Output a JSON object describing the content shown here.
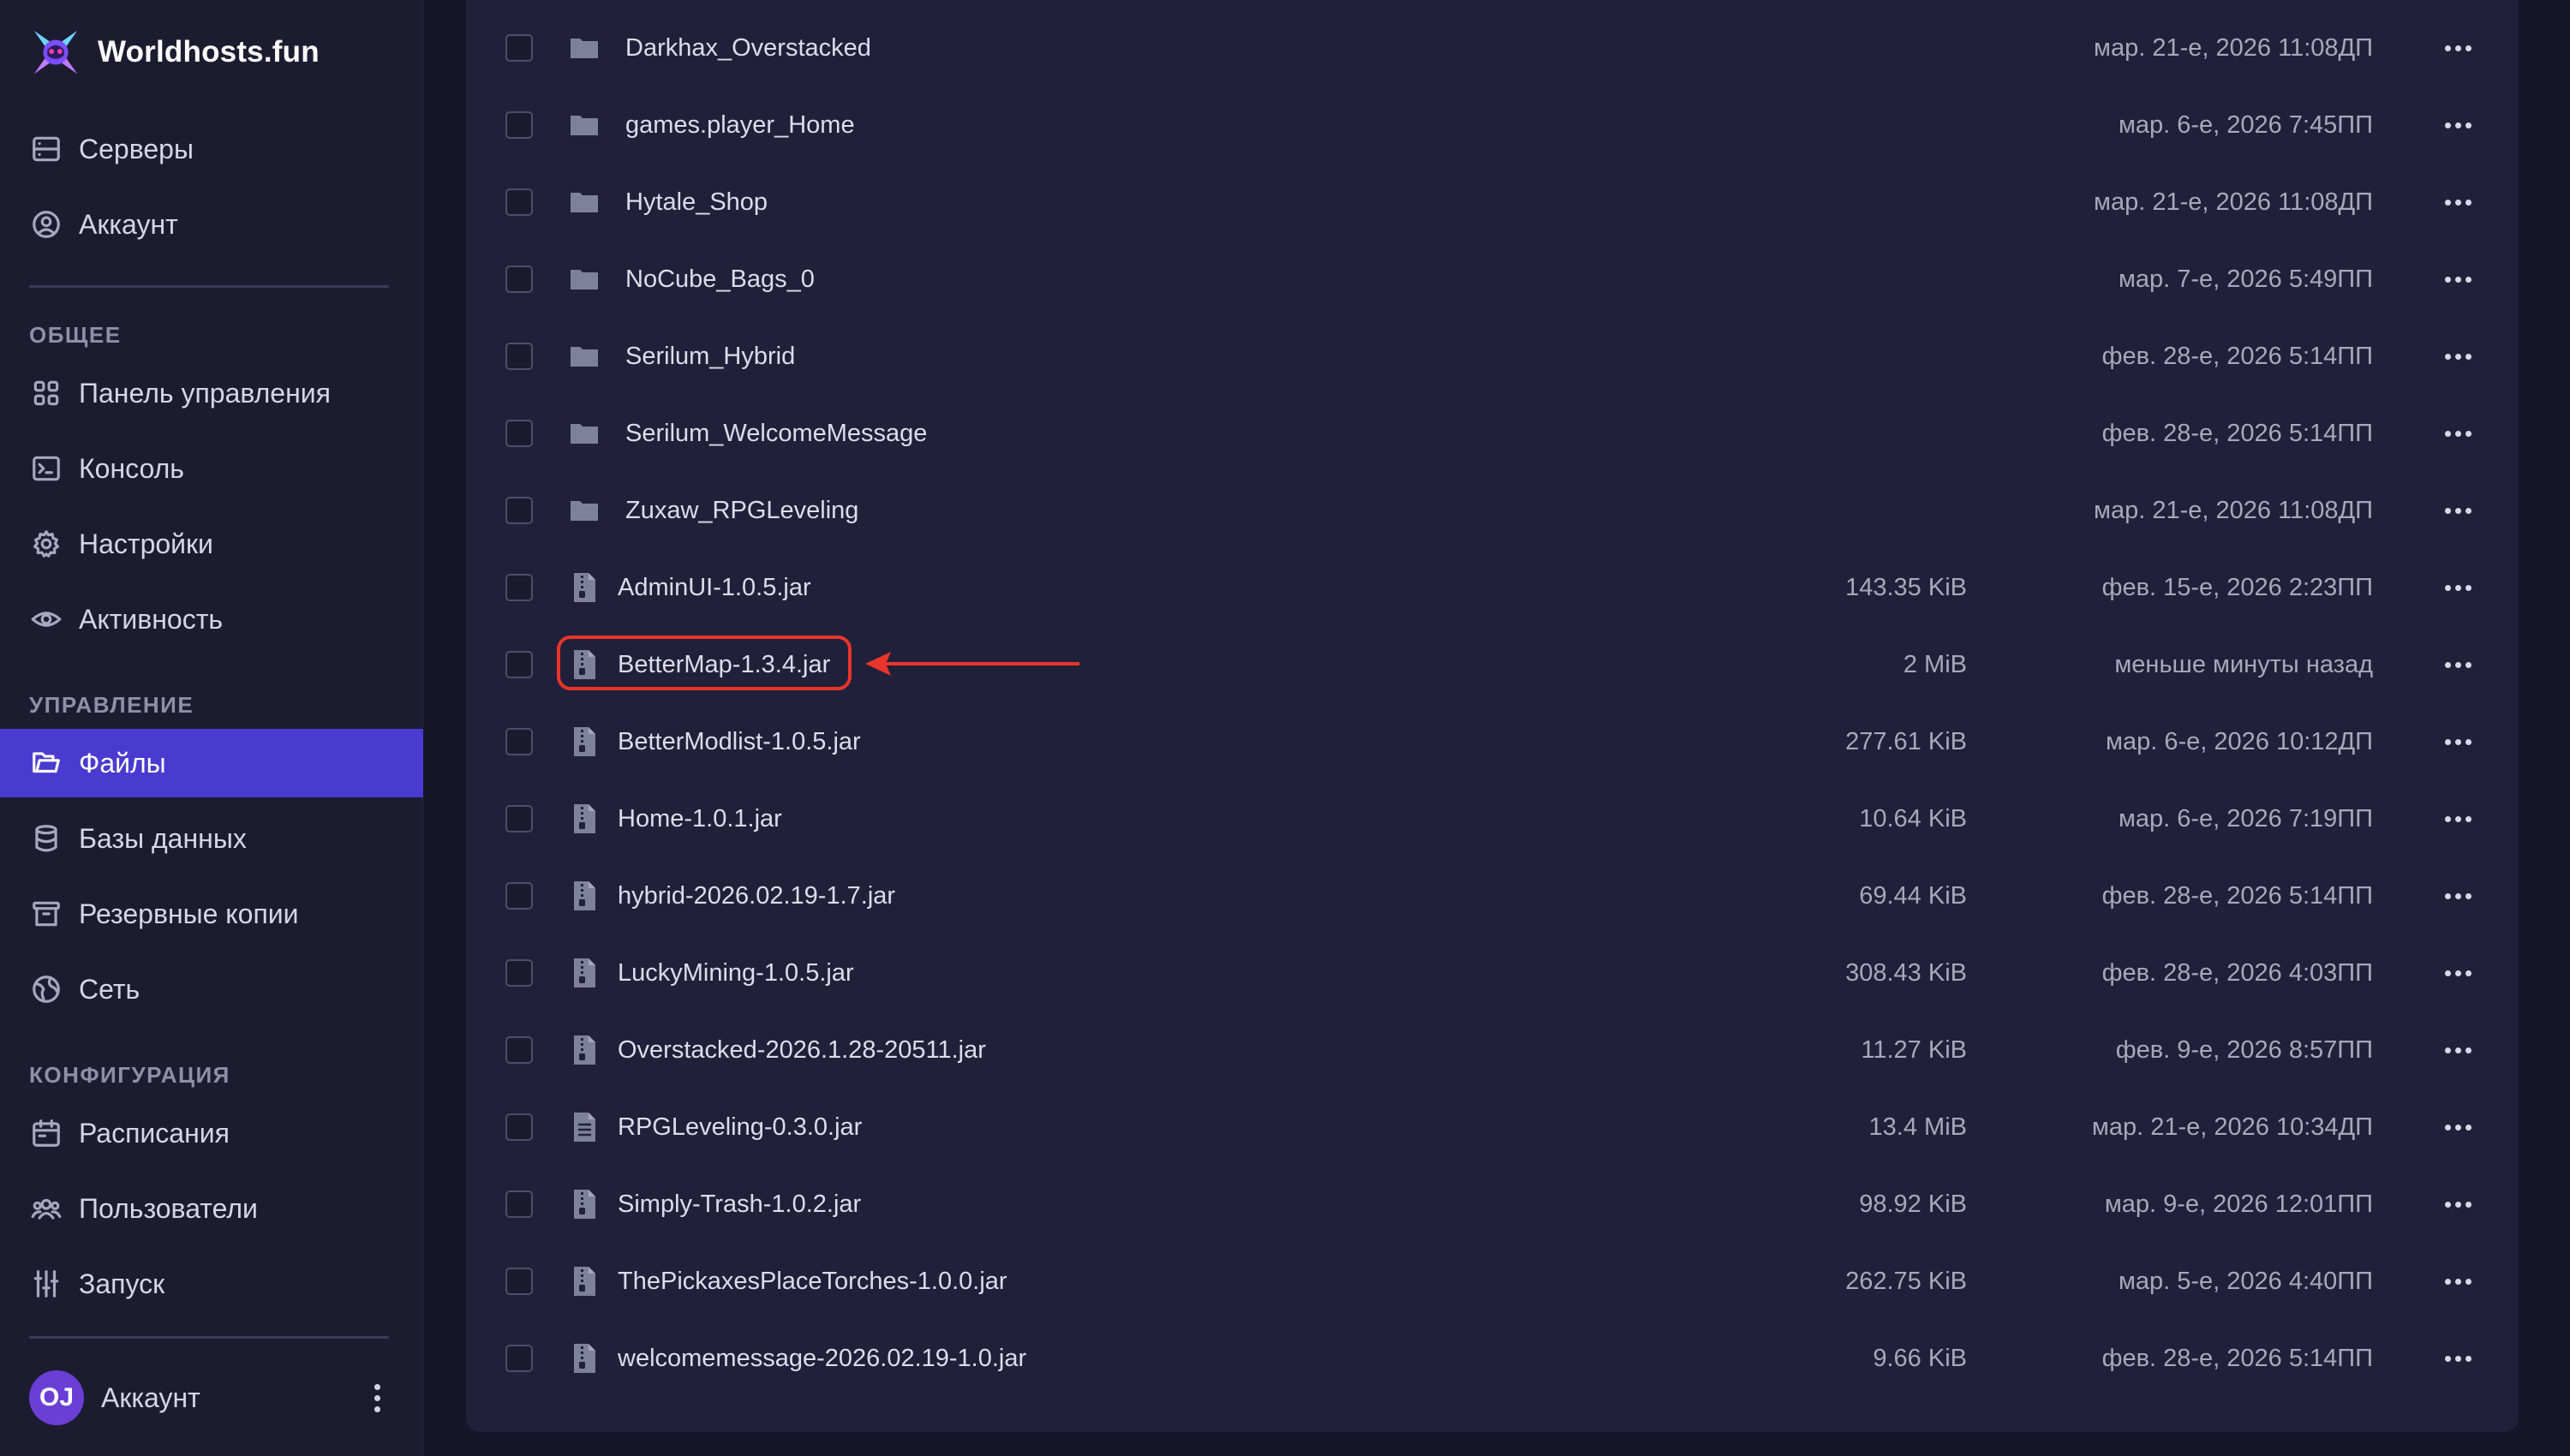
{
  "brand": {
    "name": "Worldhosts.fun"
  },
  "nav_top": [
    {
      "label": "Серверы",
      "icon": "server-icon"
    },
    {
      "label": "Аккаунт",
      "icon": "user-circle-icon"
    }
  ],
  "sections": {
    "general": "ОБЩЕЕ",
    "management": "УПРАВЛЕНИЕ",
    "configuration": "КОНФИГУРАЦИЯ"
  },
  "nav_general": [
    {
      "label": "Панель управления",
      "icon": "grid-icon"
    },
    {
      "label": "Консоль",
      "icon": "terminal-icon"
    },
    {
      "label": "Настройки",
      "icon": "gear-icon"
    },
    {
      "label": "Активность",
      "icon": "eye-icon"
    }
  ],
  "nav_management": [
    {
      "label": "Файлы",
      "icon": "folder-open-icon",
      "active": true
    },
    {
      "label": "Базы данных",
      "icon": "database-icon"
    },
    {
      "label": "Резервные копии",
      "icon": "archive-icon"
    },
    {
      "label": "Сеть",
      "icon": "globe-icon"
    }
  ],
  "nav_configuration": [
    {
      "label": "Расписания",
      "icon": "calendar-icon"
    },
    {
      "label": "Пользователи",
      "icon": "users-icon"
    },
    {
      "label": "Запуск",
      "icon": "sliders-icon"
    }
  ],
  "account": {
    "initials": "OJ",
    "name": "Аккаунт"
  },
  "files": [
    {
      "name": "Darkhax_Overstacked",
      "type": "folder",
      "size": "",
      "date": "мар. 21-е, 2026 11:08ДП"
    },
    {
      "name": "games.player_Home",
      "type": "folder",
      "size": "",
      "date": "мар. 6-е, 2026 7:45ПП"
    },
    {
      "name": "Hytale_Shop",
      "type": "folder",
      "size": "",
      "date": "мар. 21-е, 2026 11:08ДП"
    },
    {
      "name": "NoCube_Bags_0",
      "type": "folder",
      "size": "",
      "date": "мар. 7-е, 2026 5:49ПП"
    },
    {
      "name": "Serilum_Hybrid",
      "type": "folder",
      "size": "",
      "date": "фев. 28-е, 2026 5:14ПП"
    },
    {
      "name": "Serilum_WelcomeMessage",
      "type": "folder",
      "size": "",
      "date": "фев. 28-е, 2026 5:14ПП"
    },
    {
      "name": "Zuxaw_RPGLeveling",
      "type": "folder",
      "size": "",
      "date": "мар. 21-е, 2026 11:08ДП"
    },
    {
      "name": "AdminUI-1.0.5.jar",
      "type": "archive",
      "size": "143.35 KiB",
      "date": "фев. 15-е, 2026 2:23ПП"
    },
    {
      "name": "BetterMap-1.3.4.jar",
      "type": "archive",
      "size": "2 MiB",
      "date": "меньше минуты назад",
      "highlighted": true
    },
    {
      "name": "BetterModlist-1.0.5.jar",
      "type": "archive",
      "size": "277.61 KiB",
      "date": "мар. 6-е, 2026 10:12ДП"
    },
    {
      "name": "Home-1.0.1.jar",
      "type": "archive",
      "size": "10.64 KiB",
      "date": "мар. 6-е, 2026 7:19ПП"
    },
    {
      "name": "hybrid-2026.02.19-1.7.jar",
      "type": "archive",
      "size": "69.44 KiB",
      "date": "фев. 28-е, 2026 5:14ПП"
    },
    {
      "name": "LuckyMining-1.0.5.jar",
      "type": "archive",
      "size": "308.43 KiB",
      "date": "фев. 28-е, 2026 4:03ПП"
    },
    {
      "name": "Overstacked-2026.1.28-20511.jar",
      "type": "archive",
      "size": "11.27 KiB",
      "date": "фев. 9-е, 2026 8:57ПП"
    },
    {
      "name": "RPGLeveling-0.3.0.jar",
      "type": "text",
      "size": "13.4 MiB",
      "date": "мар. 21-е, 2026 10:34ДП"
    },
    {
      "name": "Simply-Trash-1.0.2.jar",
      "type": "archive",
      "size": "98.92 KiB",
      "date": "мар. 9-е, 2026 12:01ПП"
    },
    {
      "name": "ThePickaxesPlaceTorches-1.0.0.jar",
      "type": "archive",
      "size": "262.75 KiB",
      "date": "мар. 5-е, 2026 4:40ПП"
    },
    {
      "name": "welcomemessage-2026.02.19-1.0.jar",
      "type": "archive",
      "size": "9.66 KiB",
      "date": "фев. 28-е, 2026 5:14ПП"
    }
  ],
  "colors": {
    "accent": "#4a3bd0",
    "highlight": "#e8352a",
    "sidebar_bg": "#1c1c31",
    "panel_bg": "#20203a"
  }
}
